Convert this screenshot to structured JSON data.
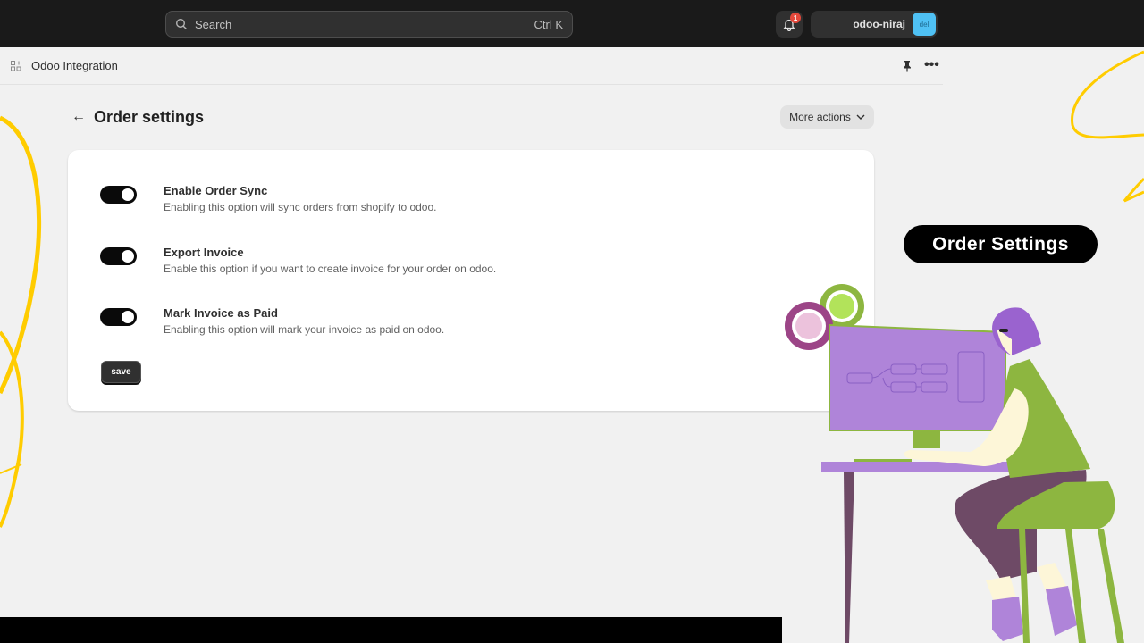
{
  "topbar": {
    "search_placeholder": "Search",
    "search_shortcut": "Ctrl K",
    "notification_count": "1",
    "account_name": "odoo-niraj",
    "account_avatar": "del",
    "avatar_color": "#4fc1f4"
  },
  "app_header": {
    "title": "Odoo Integration",
    "icons": [
      "apps-icon",
      "pin-icon",
      "more-horizontal-icon"
    ]
  },
  "page": {
    "back_icon": "arrow-left-icon",
    "title": "Order settings",
    "more_actions_label": "More actions"
  },
  "settings": [
    {
      "label": "Enable Order Sync",
      "description": "Enabling this option will sync orders from shopify to odoo.",
      "enabled": true
    },
    {
      "label": "Export Invoice",
      "description": "Enable this option if you want to create invoice for your order on odoo.",
      "enabled": true
    },
    {
      "label": "Mark Invoice as Paid",
      "description": "Enabling this option will mark your invoice as paid on odoo.",
      "enabled": true
    }
  ],
  "save_label": "save",
  "promo": {
    "badge_label": "Order Settings",
    "accent_yellow": "#ffcc00",
    "illustration": "person-at-computer-illustration"
  }
}
